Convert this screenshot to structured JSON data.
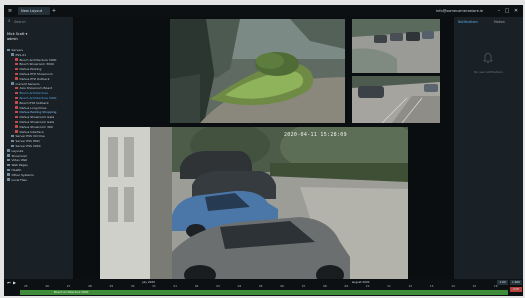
{
  "titlebar": {
    "tab_label": "New Layout",
    "user_text": "info@somecamerastore.ie",
    "menu_icon": "menu-icon",
    "close_label": "✕"
  },
  "sidebar": {
    "search_placeholder": "Search",
    "users": [
      "Mick Scott ▾",
      "admin"
    ],
    "items": [
      {
        "label": "Servers",
        "level": 0,
        "kind": "folder"
      },
      {
        "label": "PSS-01",
        "level": 1,
        "kind": "server"
      },
      {
        "label": "Bosch Architecture 3000",
        "level": 2,
        "kind": "cam"
      },
      {
        "label": "Bosch Showroom 3000",
        "level": 2,
        "kind": "cam"
      },
      {
        "label": "Dahua Parking",
        "level": 2,
        "kind": "cam"
      },
      {
        "label": "Dahua PTZ Showroom",
        "level": 2,
        "kind": "cam"
      },
      {
        "label": "Dahua PTZ Outback",
        "level": 2,
        "kind": "cam"
      },
      {
        "label": "Current Sensors",
        "level": 1,
        "kind": "server"
      },
      {
        "label": "Axis Showroom Board",
        "level": 2,
        "kind": "cam"
      },
      {
        "label": "Bosch Architecture",
        "level": 2,
        "kind": "cam",
        "state": "sel"
      },
      {
        "label": "Bosch Architecture 3000",
        "level": 2,
        "kind": "cam",
        "state": "sel"
      },
      {
        "label": "Bosch PTZ Outback",
        "level": 2,
        "kind": "cam"
      },
      {
        "label": "Dahua Long Drive",
        "level": 2,
        "kind": "cam"
      },
      {
        "label": "Dahua Parking Shopping",
        "level": 2,
        "kind": "cam",
        "state": "hl"
      },
      {
        "label": "Dahua Showroom Gate",
        "level": 2,
        "kind": "cam"
      },
      {
        "label": "Dahua Showroom Gate",
        "level": 2,
        "kind": "cam"
      },
      {
        "label": "Dahua Showroom 360",
        "level": 2,
        "kind": "cam"
      },
      {
        "label": "Dahua Interface",
        "level": 2,
        "kind": "cam"
      },
      {
        "label": "Server PSS Vid One",
        "level": 1,
        "kind": "server"
      },
      {
        "label": "Server PSS HDD",
        "level": 1,
        "kind": "server"
      },
      {
        "label": "Server PSS 2000",
        "level": 1,
        "kind": "server"
      },
      {
        "label": "Layouts",
        "level": 0,
        "kind": "folder"
      },
      {
        "label": "Showroom",
        "level": 0,
        "kind": "folder"
      },
      {
        "label": "Video Wall",
        "level": 0,
        "kind": "folder"
      },
      {
        "label": "Web Pages",
        "level": 0,
        "kind": "folder"
      },
      {
        "label": "Health",
        "level": 0,
        "kind": "folder"
      },
      {
        "label": "Other Systems",
        "level": 0,
        "kind": "folder"
      },
      {
        "label": "Local Files",
        "level": 0,
        "kind": "folder"
      }
    ]
  },
  "cameras": {
    "main_osd": "2020-04-11 15:28:09"
  },
  "right_panel": {
    "tabs": [
      "Notifications",
      "Motion"
    ],
    "empty_text": "No new notifications",
    "bell_icon": "bell-icon"
  },
  "timeline": {
    "labels_top": [
      {
        "text": "july 2020",
        "pos": 0.25
      },
      {
        "text": "august 2020",
        "pos": 0.68
      }
    ],
    "ticks": [
      "25",
      "26",
      "27",
      "28",
      "29",
      "30",
      "31",
      "01",
      "02",
      "03",
      "04",
      "05",
      "06",
      "07",
      "08",
      "09",
      "10",
      "11",
      "12",
      "13",
      "14",
      "15",
      "16"
    ],
    "camera_bar_label": "Bosch Architecture 3000",
    "zoom_buttons": [
      "1:60",
      "1:600"
    ],
    "controls": [
      "⏮",
      "▶"
    ],
    "live_label": "LIVE"
  },
  "colors": {
    "accent": "#3a88c9",
    "timeline_green": "#3e8b3a",
    "camera_red": "#c64a4a"
  }
}
